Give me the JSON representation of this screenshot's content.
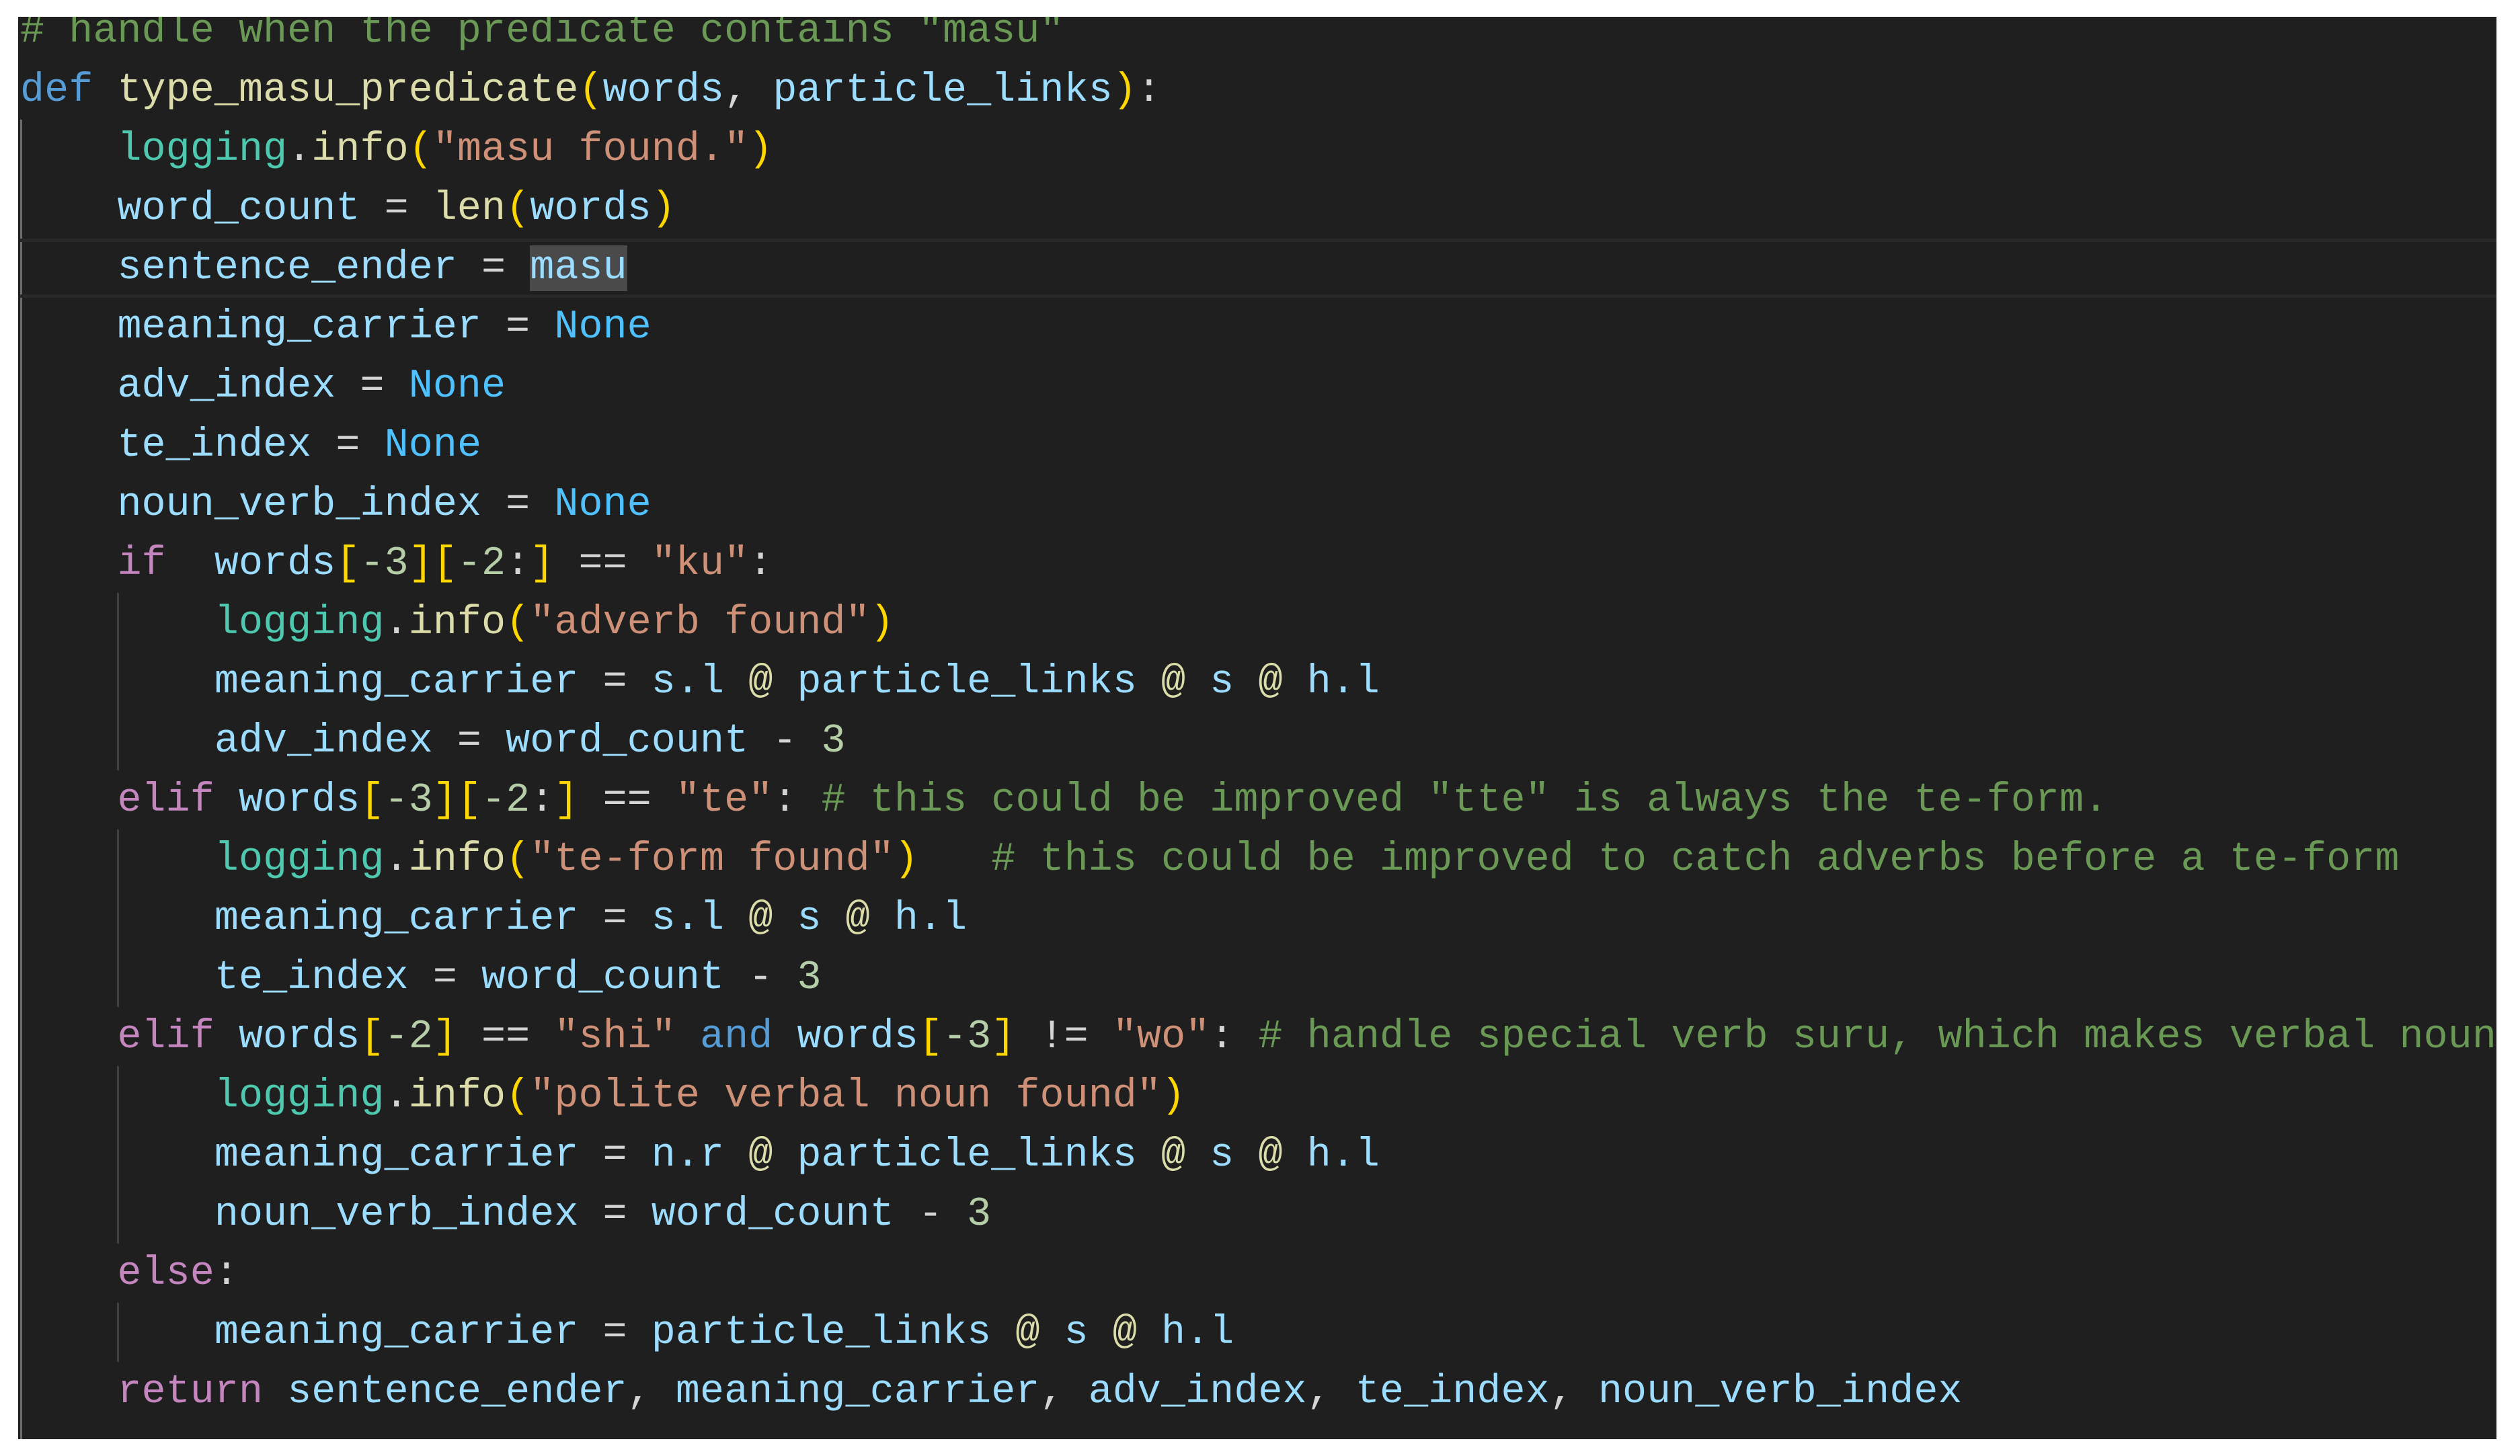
{
  "editor": {
    "theme_colors": {
      "background": "#1f1f1f",
      "comment": "#6a9955",
      "keyword": "#569cd6",
      "control": "#c586c0",
      "function": "#dcdcaa",
      "module": "#4ec9b0",
      "string": "#ce9178",
      "number": "#b5cea8",
      "constant": "#4fc1ff",
      "bracket": "#ffd700",
      "variable": "#9cdcfe",
      "selection": "#4a4a4a"
    },
    "current_line": 5,
    "selected_text": "masu",
    "lines": [
      {
        "indent": 0,
        "tokens": [
          {
            "t": "cm",
            "v": "# handle when the predicate contains \"masu\""
          }
        ]
      },
      {
        "indent": 0,
        "tokens": [
          {
            "t": "kw",
            "v": "def"
          },
          {
            "t": "op",
            "v": " "
          },
          {
            "t": "fn",
            "v": "type_masu_predicate"
          },
          {
            "t": "br1",
            "v": "("
          },
          {
            "t": "var",
            "v": "words"
          },
          {
            "t": "op",
            "v": ", "
          },
          {
            "t": "var",
            "v": "particle_links"
          },
          {
            "t": "br1",
            "v": ")"
          },
          {
            "t": "op",
            "v": ":"
          }
        ]
      },
      {
        "indent": 1,
        "tokens": [
          {
            "t": "cls",
            "v": "logging"
          },
          {
            "t": "op",
            "v": "."
          },
          {
            "t": "fn",
            "v": "info"
          },
          {
            "t": "br1",
            "v": "("
          },
          {
            "t": "str",
            "v": "\"masu found.\""
          },
          {
            "t": "br1",
            "v": ")"
          }
        ]
      },
      {
        "indent": 1,
        "tokens": [
          {
            "t": "var",
            "v": "word_count"
          },
          {
            "t": "op",
            "v": " = "
          },
          {
            "t": "fn",
            "v": "len"
          },
          {
            "t": "br1",
            "v": "("
          },
          {
            "t": "var",
            "v": "words"
          },
          {
            "t": "br1",
            "v": ")"
          }
        ]
      },
      {
        "indent": 1,
        "tokens": [
          {
            "t": "var",
            "v": "sentence_ender"
          },
          {
            "t": "op",
            "v": " = "
          },
          {
            "t": "var sel",
            "v": "masu"
          }
        ]
      },
      {
        "indent": 1,
        "tokens": [
          {
            "t": "var",
            "v": "meaning_carrier"
          },
          {
            "t": "op",
            "v": " = "
          },
          {
            "t": "const",
            "v": "None"
          }
        ]
      },
      {
        "indent": 1,
        "tokens": [
          {
            "t": "var",
            "v": "adv_index"
          },
          {
            "t": "op",
            "v": " = "
          },
          {
            "t": "const",
            "v": "None"
          }
        ]
      },
      {
        "indent": 1,
        "tokens": [
          {
            "t": "var",
            "v": "te_index"
          },
          {
            "t": "op",
            "v": " = "
          },
          {
            "t": "const",
            "v": "None"
          }
        ]
      },
      {
        "indent": 1,
        "tokens": [
          {
            "t": "var",
            "v": "noun_verb_index"
          },
          {
            "t": "op",
            "v": " = "
          },
          {
            "t": "const",
            "v": "None"
          }
        ]
      },
      {
        "indent": 1,
        "tokens": [
          {
            "t": "ctl",
            "v": "if"
          },
          {
            "t": "op",
            "v": "  "
          },
          {
            "t": "var",
            "v": "words"
          },
          {
            "t": "br1",
            "v": "["
          },
          {
            "t": "num",
            "v": "-3"
          },
          {
            "t": "br1",
            "v": "]["
          },
          {
            "t": "num",
            "v": "-2"
          },
          {
            "t": "op",
            "v": ":"
          },
          {
            "t": "br1",
            "v": "]"
          },
          {
            "t": "op",
            "v": " == "
          },
          {
            "t": "str",
            "v": "\"ku\""
          },
          {
            "t": "op",
            "v": ":"
          }
        ]
      },
      {
        "indent": 2,
        "tokens": [
          {
            "t": "cls",
            "v": "logging"
          },
          {
            "t": "op",
            "v": "."
          },
          {
            "t": "fn",
            "v": "info"
          },
          {
            "t": "br1",
            "v": "("
          },
          {
            "t": "str",
            "v": "\"adverb found\""
          },
          {
            "t": "br1",
            "v": ")"
          }
        ]
      },
      {
        "indent": 2,
        "tokens": [
          {
            "t": "var",
            "v": "meaning_carrier"
          },
          {
            "t": "op",
            "v": " = "
          },
          {
            "t": "var",
            "v": "s.l"
          },
          {
            "t": "op",
            "v": " "
          },
          {
            "t": "at",
            "v": "@"
          },
          {
            "t": "op",
            "v": " "
          },
          {
            "t": "var",
            "v": "particle_links"
          },
          {
            "t": "op",
            "v": " "
          },
          {
            "t": "at",
            "v": "@"
          },
          {
            "t": "op",
            "v": " "
          },
          {
            "t": "var",
            "v": "s"
          },
          {
            "t": "op",
            "v": " "
          },
          {
            "t": "at",
            "v": "@"
          },
          {
            "t": "op",
            "v": " "
          },
          {
            "t": "var",
            "v": "h.l"
          }
        ]
      },
      {
        "indent": 2,
        "tokens": [
          {
            "t": "var",
            "v": "adv_index"
          },
          {
            "t": "op",
            "v": " = "
          },
          {
            "t": "var",
            "v": "word_count"
          },
          {
            "t": "op",
            "v": " - "
          },
          {
            "t": "num",
            "v": "3"
          }
        ]
      },
      {
        "indent": 1,
        "tokens": [
          {
            "t": "ctl",
            "v": "elif"
          },
          {
            "t": "op",
            "v": " "
          },
          {
            "t": "var",
            "v": "words"
          },
          {
            "t": "br1",
            "v": "["
          },
          {
            "t": "num",
            "v": "-3"
          },
          {
            "t": "br1",
            "v": "]["
          },
          {
            "t": "num",
            "v": "-2"
          },
          {
            "t": "op",
            "v": ":"
          },
          {
            "t": "br1",
            "v": "]"
          },
          {
            "t": "op",
            "v": " == "
          },
          {
            "t": "str",
            "v": "\"te\""
          },
          {
            "t": "op",
            "v": ": "
          },
          {
            "t": "cm",
            "v": "# this could be improved \"tte\" is always the te-form."
          }
        ]
      },
      {
        "indent": 2,
        "tokens": [
          {
            "t": "cls",
            "v": "logging"
          },
          {
            "t": "op",
            "v": "."
          },
          {
            "t": "fn",
            "v": "info"
          },
          {
            "t": "br1",
            "v": "("
          },
          {
            "t": "str",
            "v": "\"te-form found\""
          },
          {
            "t": "br1",
            "v": ")"
          },
          {
            "t": "op",
            "v": "   "
          },
          {
            "t": "cm",
            "v": "# this could be improved to catch adverbs before a te-form"
          }
        ]
      },
      {
        "indent": 2,
        "tokens": [
          {
            "t": "var",
            "v": "meaning_carrier"
          },
          {
            "t": "op",
            "v": " = "
          },
          {
            "t": "var",
            "v": "s.l"
          },
          {
            "t": "op",
            "v": " "
          },
          {
            "t": "at",
            "v": "@"
          },
          {
            "t": "op",
            "v": " "
          },
          {
            "t": "var",
            "v": "s"
          },
          {
            "t": "op",
            "v": " "
          },
          {
            "t": "at",
            "v": "@"
          },
          {
            "t": "op",
            "v": " "
          },
          {
            "t": "var",
            "v": "h.l"
          }
        ]
      },
      {
        "indent": 2,
        "tokens": [
          {
            "t": "var",
            "v": "te_index"
          },
          {
            "t": "op",
            "v": " = "
          },
          {
            "t": "var",
            "v": "word_count"
          },
          {
            "t": "op",
            "v": " - "
          },
          {
            "t": "num",
            "v": "3"
          }
        ]
      },
      {
        "indent": 1,
        "tokens": [
          {
            "t": "ctl",
            "v": "elif"
          },
          {
            "t": "op",
            "v": " "
          },
          {
            "t": "var",
            "v": "words"
          },
          {
            "t": "br1",
            "v": "["
          },
          {
            "t": "num",
            "v": "-2"
          },
          {
            "t": "br1",
            "v": "]"
          },
          {
            "t": "op",
            "v": " == "
          },
          {
            "t": "str",
            "v": "\"shi\""
          },
          {
            "t": "op",
            "v": " "
          },
          {
            "t": "kw",
            "v": "and"
          },
          {
            "t": "op",
            "v": " "
          },
          {
            "t": "var",
            "v": "words"
          },
          {
            "t": "br1",
            "v": "["
          },
          {
            "t": "num",
            "v": "-3"
          },
          {
            "t": "br1",
            "v": "]"
          },
          {
            "t": "op",
            "v": " != "
          },
          {
            "t": "str",
            "v": "\"wo\""
          },
          {
            "t": "op",
            "v": ": "
          },
          {
            "t": "cm",
            "v": "# handle special verb suru, which makes verbal nouns"
          }
        ]
      },
      {
        "indent": 2,
        "tokens": [
          {
            "t": "cls",
            "v": "logging"
          },
          {
            "t": "op",
            "v": "."
          },
          {
            "t": "fn",
            "v": "info"
          },
          {
            "t": "br1",
            "v": "("
          },
          {
            "t": "str",
            "v": "\"polite verbal noun found\""
          },
          {
            "t": "br1",
            "v": ")"
          }
        ]
      },
      {
        "indent": 2,
        "tokens": [
          {
            "t": "var",
            "v": "meaning_carrier"
          },
          {
            "t": "op",
            "v": " = "
          },
          {
            "t": "var",
            "v": "n.r"
          },
          {
            "t": "op",
            "v": " "
          },
          {
            "t": "at",
            "v": "@"
          },
          {
            "t": "op",
            "v": " "
          },
          {
            "t": "var",
            "v": "particle_links"
          },
          {
            "t": "op",
            "v": " "
          },
          {
            "t": "at",
            "v": "@"
          },
          {
            "t": "op",
            "v": " "
          },
          {
            "t": "var",
            "v": "s"
          },
          {
            "t": "op",
            "v": " "
          },
          {
            "t": "at",
            "v": "@"
          },
          {
            "t": "op",
            "v": " "
          },
          {
            "t": "var",
            "v": "h.l"
          }
        ]
      },
      {
        "indent": 2,
        "tokens": [
          {
            "t": "var",
            "v": "noun_verb_index"
          },
          {
            "t": "op",
            "v": " = "
          },
          {
            "t": "var",
            "v": "word_count"
          },
          {
            "t": "op",
            "v": " - "
          },
          {
            "t": "num",
            "v": "3"
          }
        ]
      },
      {
        "indent": 1,
        "tokens": [
          {
            "t": "ctl",
            "v": "else"
          },
          {
            "t": "op",
            "v": ":"
          }
        ]
      },
      {
        "indent": 2,
        "tokens": [
          {
            "t": "var",
            "v": "meaning_carrier"
          },
          {
            "t": "op",
            "v": " = "
          },
          {
            "t": "var",
            "v": "particle_links"
          },
          {
            "t": "op",
            "v": " "
          },
          {
            "t": "at",
            "v": "@"
          },
          {
            "t": "op",
            "v": " "
          },
          {
            "t": "var",
            "v": "s"
          },
          {
            "t": "op",
            "v": " "
          },
          {
            "t": "at",
            "v": "@"
          },
          {
            "t": "op",
            "v": " "
          },
          {
            "t": "var",
            "v": "h.l"
          }
        ]
      },
      {
        "indent": 1,
        "tokens": [
          {
            "t": "ctl",
            "v": "return"
          },
          {
            "t": "op",
            "v": " "
          },
          {
            "t": "var",
            "v": "sentence_ender"
          },
          {
            "t": "op",
            "v": ", "
          },
          {
            "t": "var",
            "v": "meaning_carrier"
          },
          {
            "t": "op",
            "v": ", "
          },
          {
            "t": "var",
            "v": "adv_index"
          },
          {
            "t": "op",
            "v": ", "
          },
          {
            "t": "var",
            "v": "te_index"
          },
          {
            "t": "op",
            "v": ", "
          },
          {
            "t": "var",
            "v": "noun_verb_index"
          }
        ]
      }
    ]
  }
}
